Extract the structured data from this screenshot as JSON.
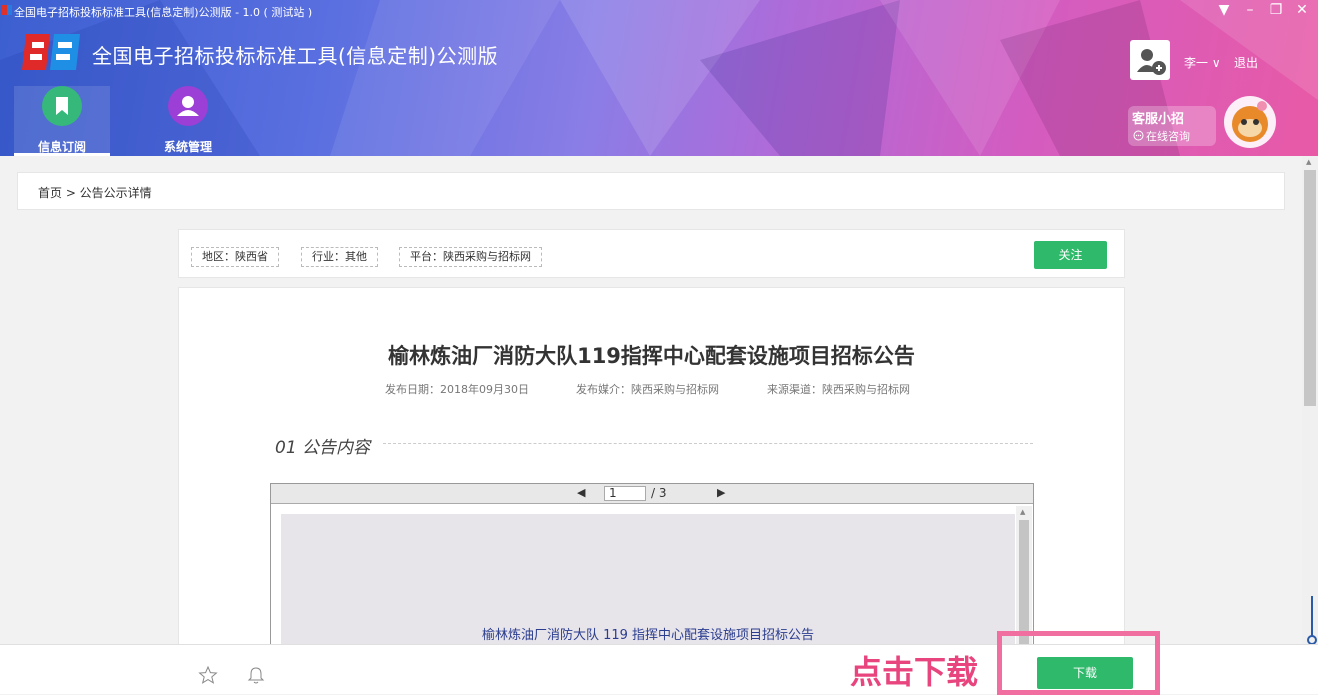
{
  "window": {
    "title": "全国电子招标投标标准工具(信息定制)公测版 - 1.0 ( 测试站 )",
    "controls": [
      "▼",
      "–",
      "❐",
      "✕"
    ]
  },
  "app": {
    "name": "全国电子招标投标标准工具(信息定制)公测版"
  },
  "nav": [
    {
      "label": "信息订阅",
      "icon": "bookmark-icon",
      "color": "#36b87a",
      "active": true
    },
    {
      "label": "系统管理",
      "icon": "user-icon",
      "color": "#9b3fd6",
      "active": false
    }
  ],
  "user": {
    "name": "李一 ∨",
    "logout": "退出",
    "avatar_icon": "add-user-icon"
  },
  "service": {
    "title": "客服小招",
    "subtitle": "在线咨询",
    "chat_icon": "chat-bubble-icon",
    "mascot_icon": "mascot-icon"
  },
  "breadcrumb": "首页 > 公告公示详情",
  "tags": [
    "地区：陕西省",
    "行业：其他",
    "平台：陕西采购与招标网"
  ],
  "follow_button": "关注",
  "article": {
    "title": "榆林炼油厂消防大队119指挥中心配套设施项目招标公告",
    "meta_date": "发布日期：2018年09月30日",
    "meta_media": "发布媒介：陕西采购与招标网",
    "meta_source": "来源渠道：陕西采购与招标网",
    "section_heading": "01 公告内容"
  },
  "viewer": {
    "prev_icon": "◀",
    "next_icon": "▶",
    "current_page": "1",
    "total_pages": "/ 3",
    "doc_title": "榆林炼油厂消防大队 119 指挥中心配套设施项目招标公告"
  },
  "bottom": {
    "star_icon": "star-icon",
    "bell_icon": "bell-icon",
    "hint": "点击下载",
    "download_button": "下载"
  },
  "colors": {
    "accent_green": "#2fb96a",
    "highlight_pink": "#f06fa0",
    "hint_pink": "#e8457e"
  }
}
